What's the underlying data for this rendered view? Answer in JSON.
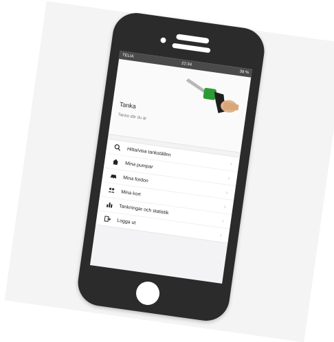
{
  "status_bar": {
    "carrier": "TELIA",
    "time": "22:34",
    "battery": "39 %"
  },
  "hero": {
    "title": "Tanka",
    "subtitle": "Tanka där du är"
  },
  "menu": {
    "items": [
      {
        "label": "Hitta/visa tankställen",
        "icon": "search-icon"
      },
      {
        "label": "Mina pumpar",
        "icon": "home-icon"
      },
      {
        "label": "Mina fordon",
        "icon": "car-icon"
      },
      {
        "label": "Mina kort",
        "icon": "users-icon"
      },
      {
        "label": "Tankningar och statistik",
        "icon": "bar-chart-icon"
      },
      {
        "label": "Logga ut",
        "icon": "logout-icon"
      }
    ]
  },
  "colors": {
    "phone_bezel": "#2b2b2b",
    "screen_bg": "#f3f3f5",
    "status_bar_bg": "#4a4a4a",
    "nozzle_green": "#2e9a35"
  }
}
